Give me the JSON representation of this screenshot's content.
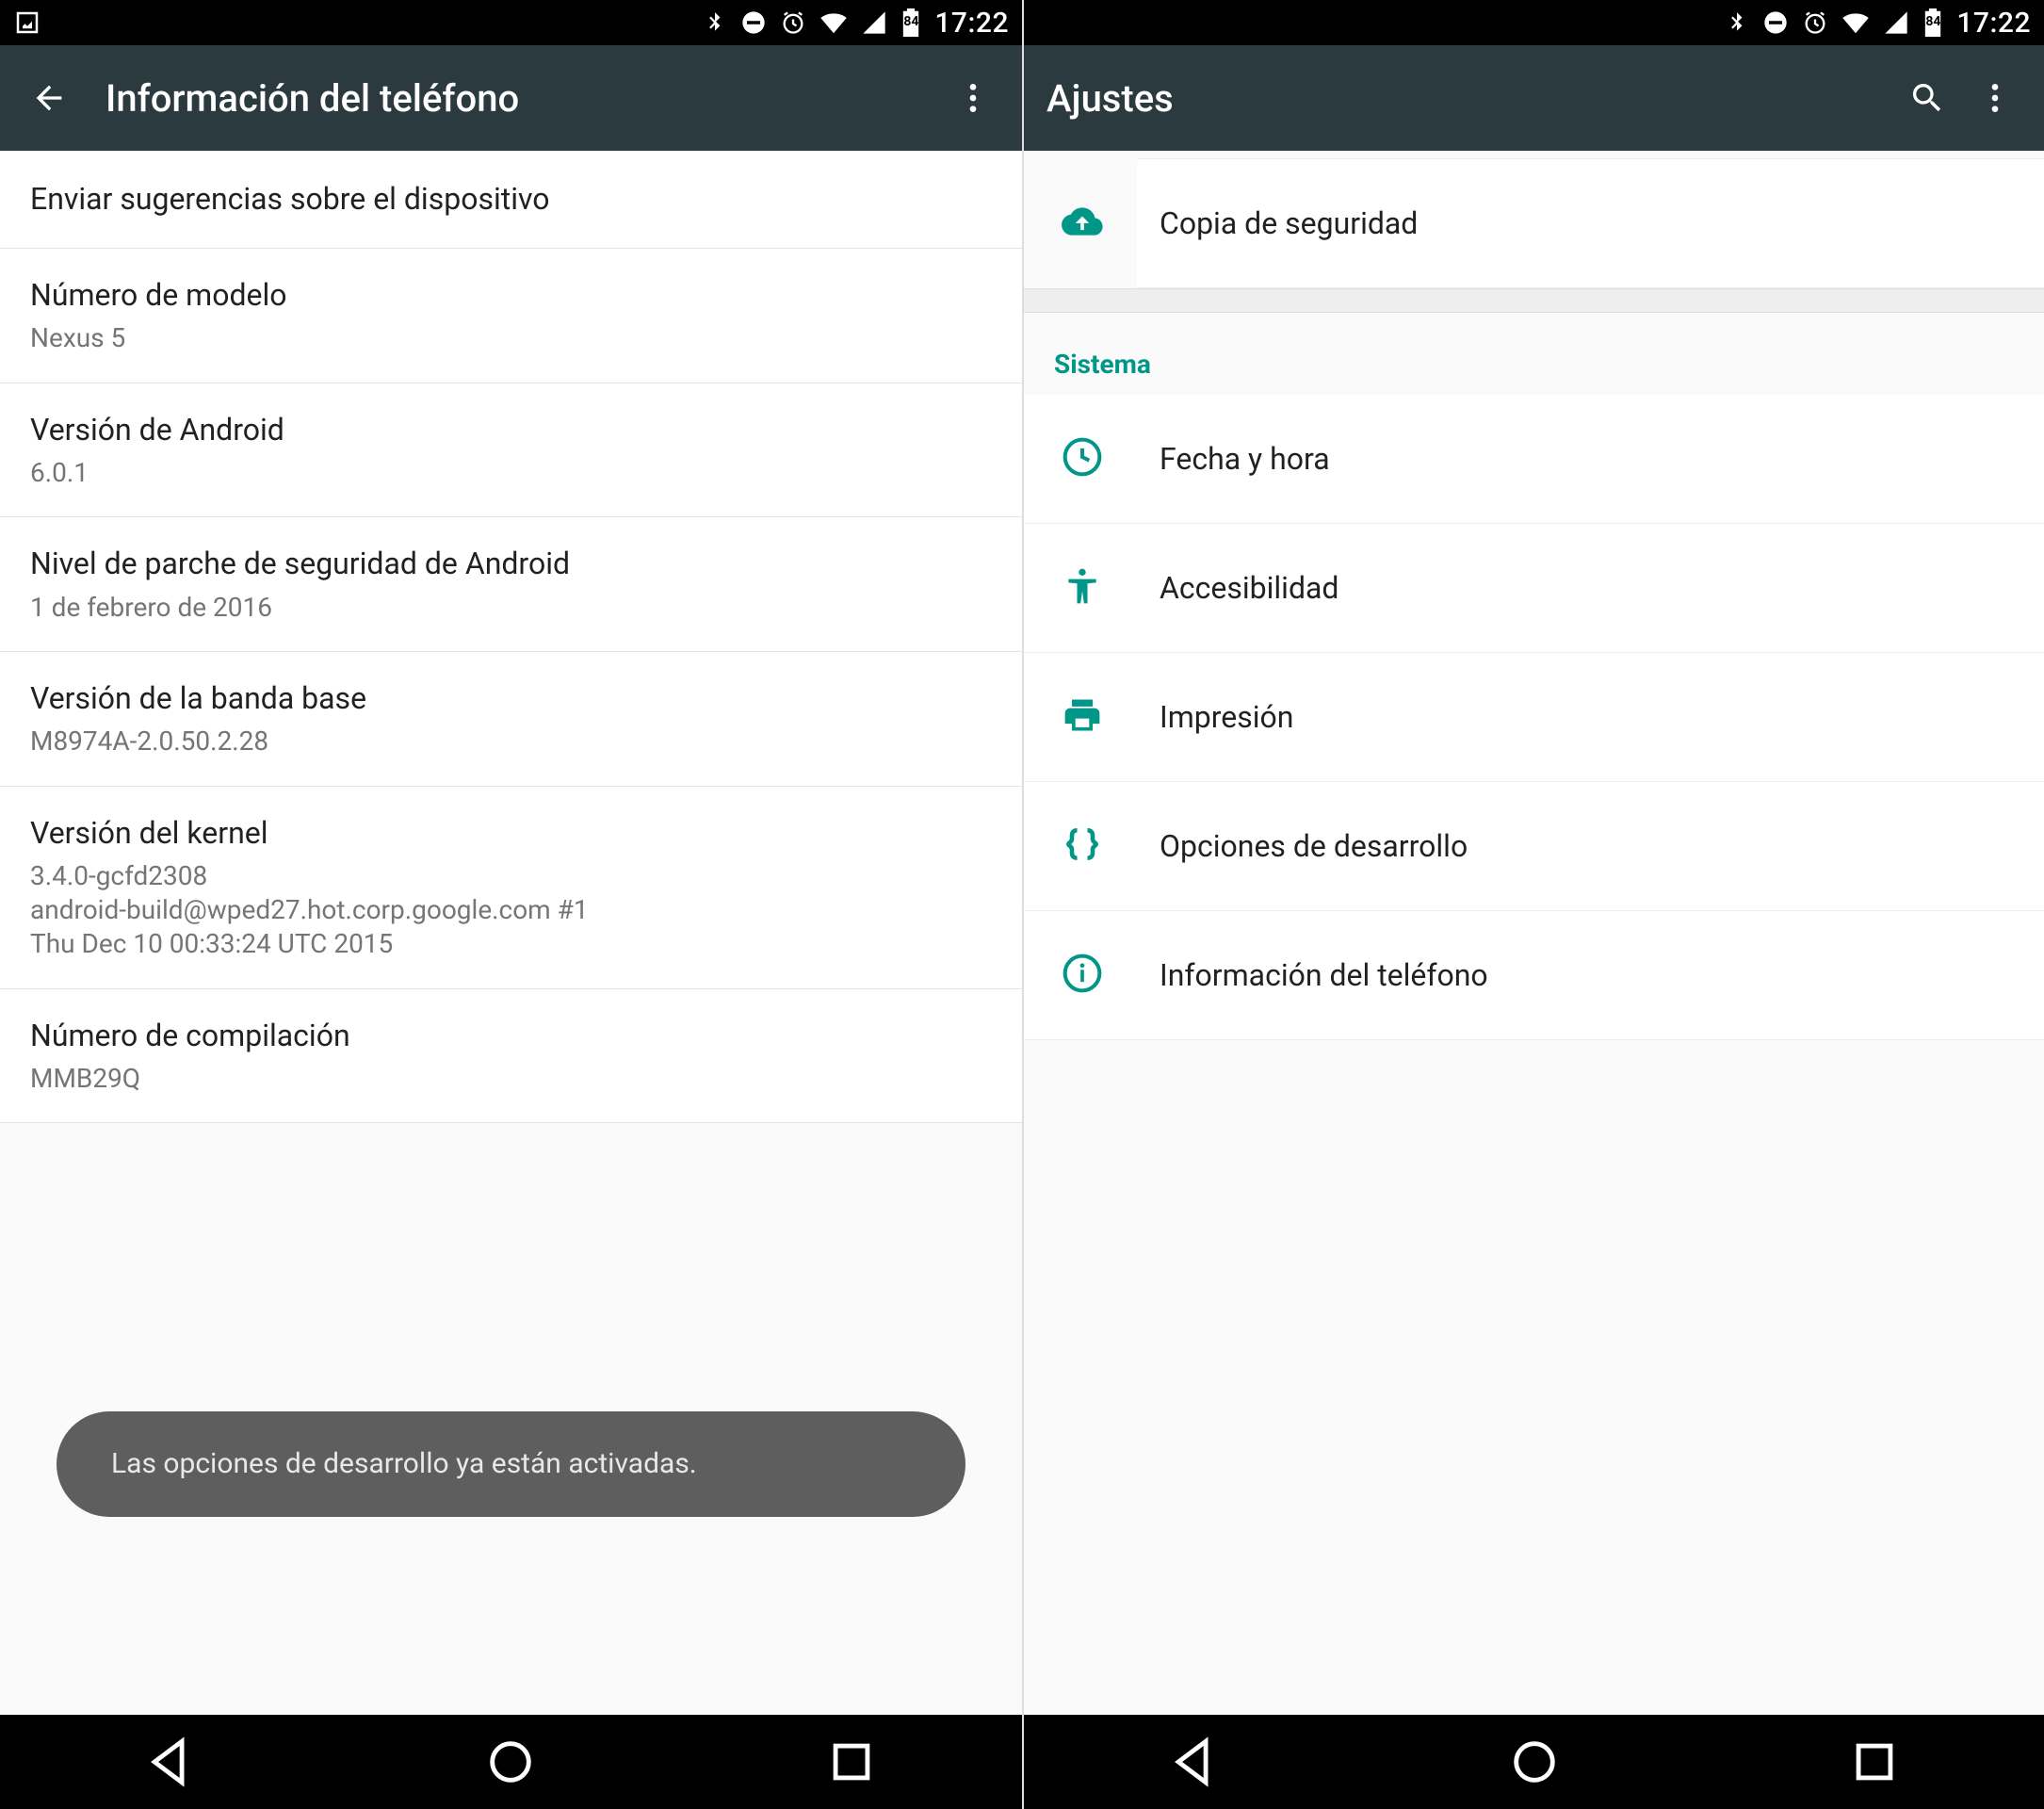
{
  "status": {
    "battery": "84",
    "time": "17:22"
  },
  "left": {
    "title": "Información del teléfono",
    "rows": [
      {
        "title": "Enviar sugerencias sobre el dispositivo"
      },
      {
        "title": "Número de modelo",
        "sub": "Nexus 5"
      },
      {
        "title": "Versión de Android",
        "sub": "6.0.1"
      },
      {
        "title": "Nivel de parche de seguridad de Android",
        "sub": "1 de febrero de 2016"
      },
      {
        "title": "Versión de la banda base",
        "sub": "M8974A-2.0.50.2.28"
      },
      {
        "title": "Versión del kernel",
        "sub": "3.4.0-gcfd2308\nandroid-build@wped27.hot.corp.google.com #1\nThu Dec 10 00:33:24 UTC 2015"
      },
      {
        "title": "Número de compilación",
        "sub": "MMB29Q"
      }
    ],
    "toast": "Las opciones de desarrollo ya están activadas."
  },
  "right": {
    "title": "Ajustes",
    "backup": "Copia de seguridad",
    "section": "Sistema",
    "items": [
      {
        "label": "Fecha y hora",
        "icon": "clock-icon"
      },
      {
        "label": "Accesibilidad",
        "icon": "accessibility-icon"
      },
      {
        "label": "Impresión",
        "icon": "print-icon"
      },
      {
        "label": "Opciones de desarrollo",
        "icon": "braces-icon"
      },
      {
        "label": "Información del teléfono",
        "icon": "info-icon"
      }
    ]
  }
}
